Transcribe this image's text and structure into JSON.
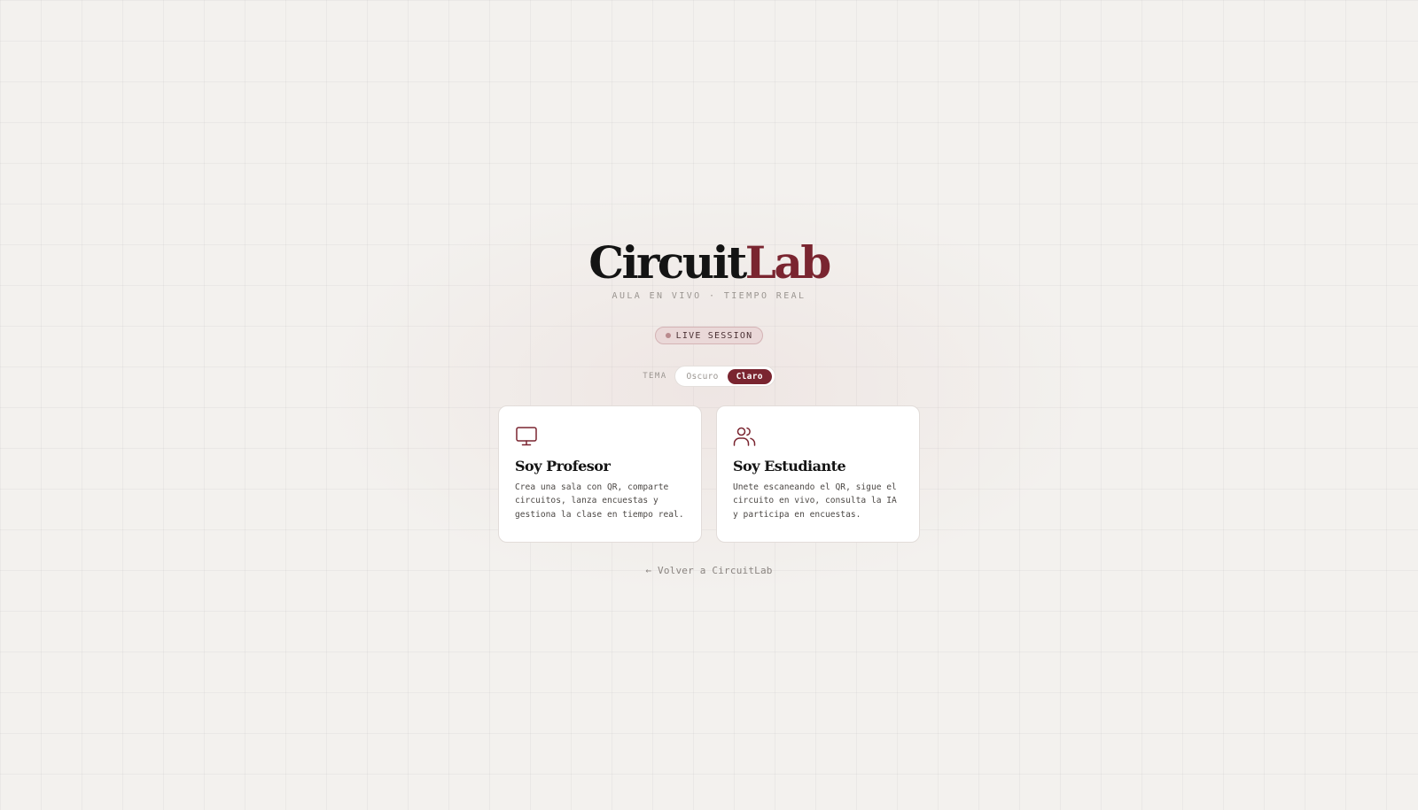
{
  "brand": {
    "part1": "Circuit",
    "part2": "Lab",
    "tagline": "AULA EN VIVO · TIEMPO REAL",
    "accent_color": "#7a2530"
  },
  "badge": {
    "label": "LIVE SESSION",
    "icon": "dot-icon"
  },
  "theme": {
    "label": "TEMA",
    "options": [
      "Oscuro",
      "Claro"
    ],
    "selected": "Claro"
  },
  "roles": [
    {
      "icon": "monitor-icon",
      "title": "Soy Profesor",
      "description": "Crea una sala con QR, comparte circuitos, lanza encuestas y gestiona la clase en tiempo real."
    },
    {
      "icon": "users-icon",
      "title": "Soy Estudiante",
      "description": "Unete escaneando el QR, sigue el circuito en vivo, consulta la IA y participa en encuestas."
    }
  ],
  "back_link": {
    "arrow": "←",
    "label": "Volver a CircuitLab"
  }
}
